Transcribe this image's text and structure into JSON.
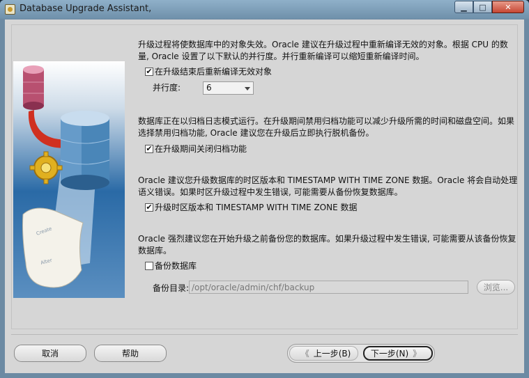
{
  "window": {
    "title": "Database Upgrade Assistant,",
    "controls": {
      "minimize": "▁",
      "maximize": "□",
      "close": "✕"
    }
  },
  "sections": {
    "recompile": {
      "text": "升级过程将使数据库中的对象失效。Oracle 建议在升级过程中重新编译无效的对象。根据 CPU 的数量, Oracle 设置了以下默认的并行度。并行重新编译可以缩短重新编译时间。",
      "checkbox_label": "在升级结束后重新编译无效对象",
      "checked": true,
      "parallel_label": "并行度:",
      "parallel_value": "6"
    },
    "archive": {
      "text": "数据库正在以归档日志模式运行。在升级期间禁用归档功能可以减少升级所需的时间和磁盘空间。如果选择禁用归档功能, Oracle 建议您在升级后立即执行脱机备份。",
      "checkbox_label": "在升级期间关闭归档功能",
      "checked": true
    },
    "timezone": {
      "text": "Oracle 建议您升级数据库的时区版本和 TIMESTAMP WITH TIME ZONE 数据。Oracle 将会自动处理语义错误。如果时区升级过程中发生错误, 可能需要从备份恢复数据库。",
      "checkbox_label": "升级时区版本和 TIMESTAMP WITH TIME ZONE 数据",
      "checked": true
    },
    "backup": {
      "text": "Oracle 强烈建议您在开始升级之前备份您的数据库。如果升级过程中发生错误, 可能需要从该备份恢复数据库。",
      "checkbox_label": "备份数据库",
      "checked": false,
      "dir_label": "备份目录:",
      "dir_value": "/opt/oracle/admin/chf/backup",
      "browse_label": "浏览..."
    }
  },
  "buttons": {
    "cancel": "取消",
    "help": "帮助",
    "back": "上一步(B)",
    "next": "下一步(N)",
    "back_glyph": "《",
    "next_glyph": "》"
  },
  "illustration": {
    "text_left": "Create",
    "text_right": "Alter"
  },
  "colors": {
    "window_frame": "#6c8aa3",
    "client_bg": "#d6d6d6",
    "close_button": "#c64633"
  }
}
